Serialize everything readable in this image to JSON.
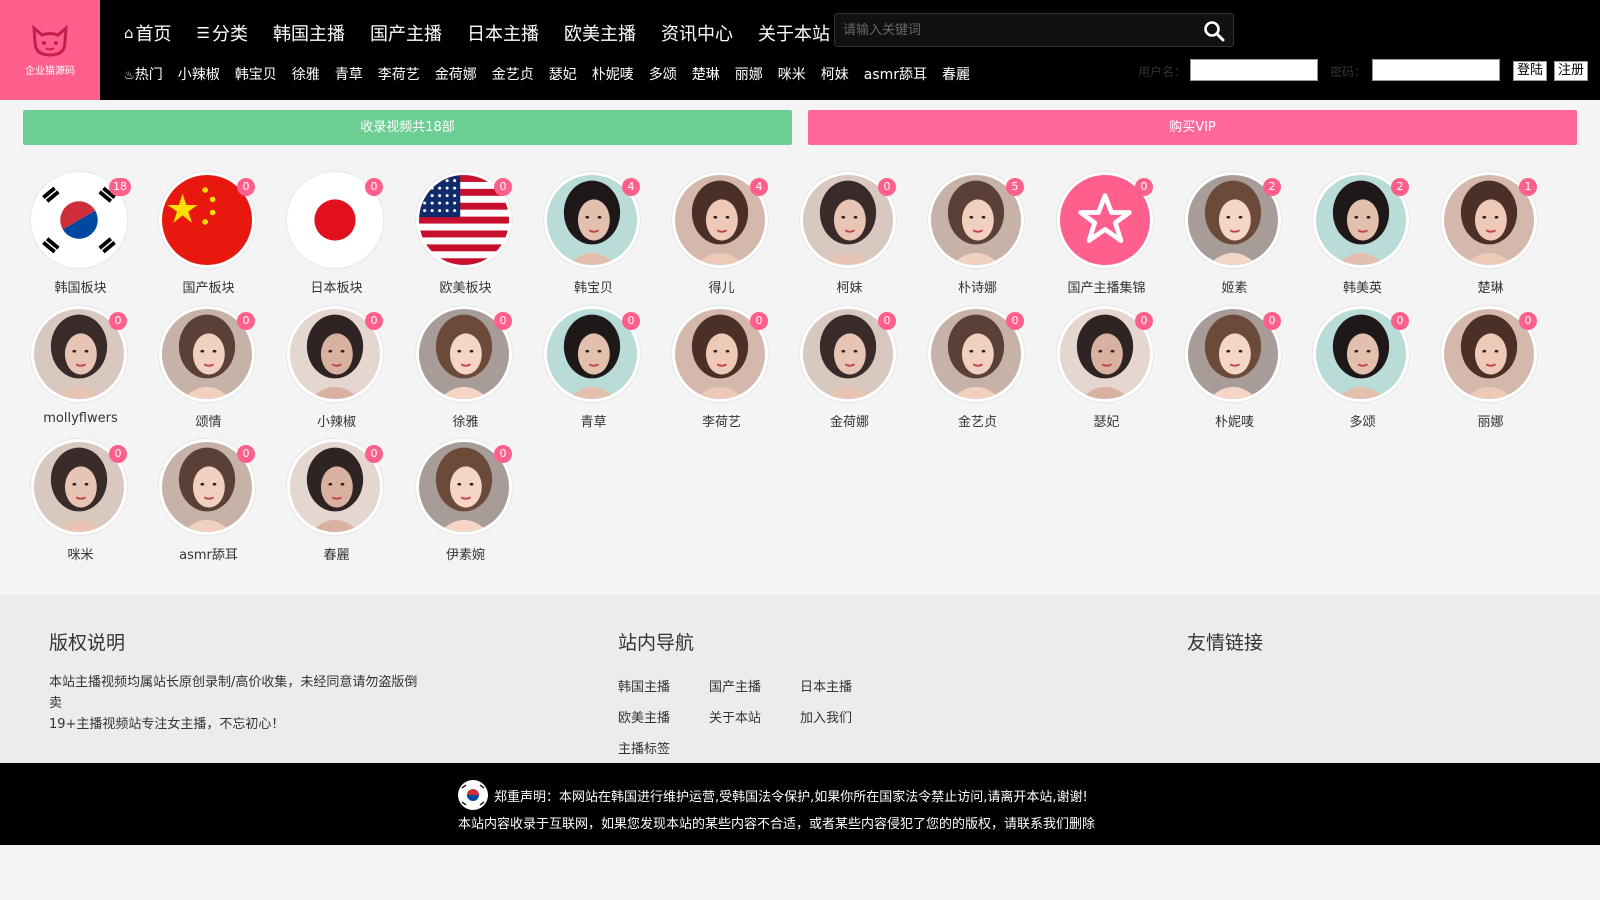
{
  "logo": {
    "text": "企业猫源码"
  },
  "main_nav": [
    {
      "label": "首页",
      "icon": "home-icon"
    },
    {
      "label": "分类",
      "icon": "list-icon"
    },
    {
      "label": "韩国主播"
    },
    {
      "label": "国产主播"
    },
    {
      "label": "日本主播"
    },
    {
      "label": "欧美主播"
    },
    {
      "label": "资讯中心"
    },
    {
      "label": "关于本站"
    }
  ],
  "search": {
    "placeholder": "请输入关键词",
    "icon": "search-icon"
  },
  "tag_nav": [
    {
      "label": "热门",
      "icon": "fire-icon"
    },
    {
      "label": "小辣椒"
    },
    {
      "label": "韩宝贝"
    },
    {
      "label": "徐雅"
    },
    {
      "label": "青草"
    },
    {
      "label": "李荷艺"
    },
    {
      "label": "金荷娜"
    },
    {
      "label": "金艺贞"
    },
    {
      "label": "瑟妃"
    },
    {
      "label": "朴妮唛"
    },
    {
      "label": "多颂"
    },
    {
      "label": "楚琳"
    },
    {
      "label": "丽娜"
    },
    {
      "label": "咪米"
    },
    {
      "label": "柯妹"
    },
    {
      "label": "asmr舔耳"
    },
    {
      "label": "春麗"
    }
  ],
  "login": {
    "username_label": "用户名：",
    "password_label": "密码：",
    "login_btn": "登陆",
    "register_btn": "注册"
  },
  "banner": {
    "left": "收录视频共18部",
    "right": "购买VIP"
  },
  "colors": {
    "accent_pink": "#ff5f8d",
    "green": "#6dce93",
    "vip_pink": "#ff679a"
  },
  "categories": [
    {
      "name": "韩国板块",
      "count": "18",
      "avatar": "korea-flag"
    },
    {
      "name": "国产板块",
      "count": "0",
      "avatar": "china-flag"
    },
    {
      "name": "日本板块",
      "count": "0",
      "avatar": "japan-flag"
    },
    {
      "name": "欧美板块",
      "count": "0",
      "avatar": "usa-flag"
    },
    {
      "name": "韩宝贝",
      "count": "4",
      "avatar": "photo"
    },
    {
      "name": "得儿",
      "count": "4",
      "avatar": "photo"
    },
    {
      "name": "柯妹",
      "count": "0",
      "avatar": "photo"
    },
    {
      "name": "朴诗娜",
      "count": "5",
      "avatar": "photo"
    },
    {
      "name": "国产主播集锦",
      "count": "0",
      "avatar": "star-icon"
    },
    {
      "name": "姬素",
      "count": "2",
      "avatar": "photo"
    },
    {
      "name": "韩美英",
      "count": "2",
      "avatar": "photo"
    },
    {
      "name": "楚琳",
      "count": "1",
      "avatar": "photo"
    },
    {
      "name": "mollyflwers",
      "count": "0",
      "avatar": "photo"
    },
    {
      "name": "颂情",
      "count": "0",
      "avatar": "photo"
    },
    {
      "name": "小辣椒",
      "count": "0",
      "avatar": "photo"
    },
    {
      "name": "徐雅",
      "count": "0",
      "avatar": "photo"
    },
    {
      "name": "青草",
      "count": "0",
      "avatar": "photo"
    },
    {
      "name": "李荷艺",
      "count": "0",
      "avatar": "photo"
    },
    {
      "name": "金荷娜",
      "count": "0",
      "avatar": "photo"
    },
    {
      "name": "金艺贞",
      "count": "0",
      "avatar": "photo"
    },
    {
      "name": "瑟妃",
      "count": "0",
      "avatar": "photo"
    },
    {
      "name": "朴妮唛",
      "count": "0",
      "avatar": "photo"
    },
    {
      "name": "多颂",
      "count": "0",
      "avatar": "photo"
    },
    {
      "name": "丽娜",
      "count": "0",
      "avatar": "photo"
    },
    {
      "name": "咪米",
      "count": "0",
      "avatar": "photo"
    },
    {
      "name": "asmr舔耳",
      "count": "0",
      "avatar": "photo"
    },
    {
      "name": "春麗",
      "count": "0",
      "avatar": "photo"
    },
    {
      "name": "伊素婉",
      "count": "0",
      "avatar": "photo"
    }
  ],
  "footer": {
    "copyright_title": "版权说明",
    "copyright_text_1": "本站主播视频均属站长原创录制/高价收集，未经同意请勿盗版倒卖",
    "copyright_text_2": "19+主播视频站专注女主播，不忘初心！",
    "nav_title": "站内导航",
    "nav_links": [
      "韩国主播",
      "国产主播",
      "日本主播",
      "欧美主播",
      "关于本站",
      "加入我们",
      "主播标签"
    ],
    "friends_title": "友情链接"
  },
  "notice": {
    "line1": "郑重声明：本网站在韩国进行维护运营,受韩国法令保护,如果你所在国家法令禁止访问,请离开本站,谢谢!",
    "line2": "本站内容收录于互联网，如果您发现本站的某些内容不合适，或者某些内容侵犯了您的的版权，请联系我们删除"
  }
}
